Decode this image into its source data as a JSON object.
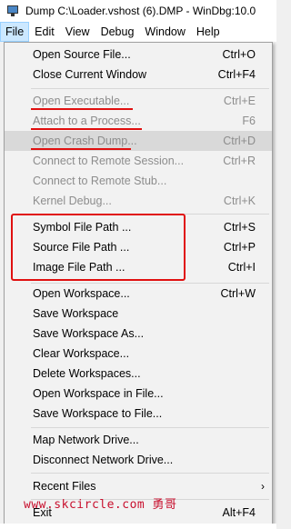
{
  "window": {
    "title": "Dump C:\\Loader.vshost (6).DMP - WinDbg:10.0"
  },
  "menubar": [
    {
      "label": "File",
      "active": true
    },
    {
      "label": "Edit"
    },
    {
      "label": "View"
    },
    {
      "label": "Debug"
    },
    {
      "label": "Window"
    },
    {
      "label": "Help"
    }
  ],
  "file_menu": {
    "items": [
      {
        "label": "Open Source File...",
        "shortcut": "Ctrl+O",
        "enabled": true
      },
      {
        "label": "Close Current Window",
        "shortcut": "Ctrl+F4",
        "enabled": true
      },
      {
        "label": "Open Executable...",
        "shortcut": "Ctrl+E",
        "enabled": false
      },
      {
        "label": "Attach to a Process...",
        "shortcut": "F6",
        "enabled": false
      },
      {
        "label": "Open Crash Dump...",
        "shortcut": "Ctrl+D",
        "enabled": false,
        "highlighted": true
      },
      {
        "label": "Connect to Remote Session...",
        "shortcut": "Ctrl+R",
        "enabled": false
      },
      {
        "label": "Connect to Remote Stub...",
        "shortcut": "",
        "enabled": false
      },
      {
        "label": "Kernel Debug...",
        "shortcut": "Ctrl+K",
        "enabled": false
      },
      {
        "label": "Symbol File Path ...",
        "shortcut": "Ctrl+S",
        "enabled": true
      },
      {
        "label": "Source File Path ...",
        "shortcut": "Ctrl+P",
        "enabled": true
      },
      {
        "label": "Image File Path ...",
        "shortcut": "Ctrl+I",
        "enabled": true
      },
      {
        "label": "Open Workspace...",
        "shortcut": "Ctrl+W",
        "enabled": true
      },
      {
        "label": "Save Workspace",
        "shortcut": "",
        "enabled": true
      },
      {
        "label": "Save Workspace As...",
        "shortcut": "",
        "enabled": true
      },
      {
        "label": "Clear Workspace...",
        "shortcut": "",
        "enabled": true
      },
      {
        "label": "Delete Workspaces...",
        "shortcut": "",
        "enabled": true
      },
      {
        "label": "Open Workspace in File...",
        "shortcut": "",
        "enabled": true
      },
      {
        "label": "Save Workspace to File...",
        "shortcut": "",
        "enabled": true
      },
      {
        "label": "Map Network Drive...",
        "shortcut": "",
        "enabled": true
      },
      {
        "label": "Disconnect Network Drive...",
        "shortcut": "",
        "enabled": true
      },
      {
        "label": "Recent Files",
        "shortcut": "",
        "enabled": true,
        "submenu": true
      },
      {
        "label": "Exit",
        "shortcut": "Alt+F4",
        "enabled": true
      }
    ]
  },
  "annotation": {
    "color": "#e01010"
  },
  "watermark": "www.skcircle.com 勇哥"
}
